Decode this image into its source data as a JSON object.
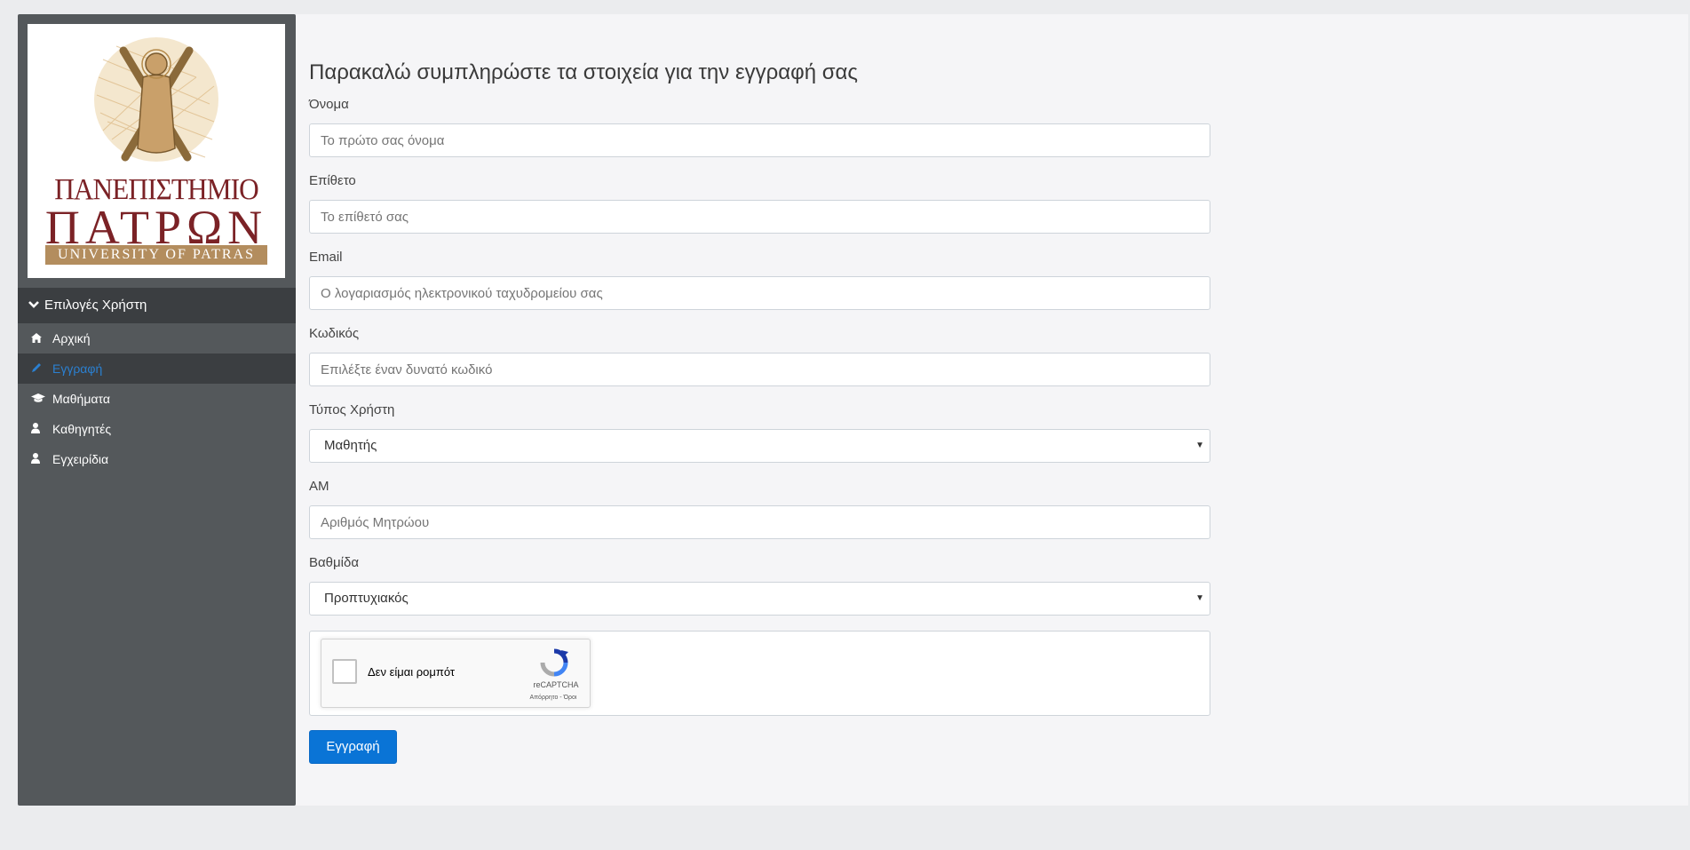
{
  "sidebar": {
    "logo": {
      "greek_line1": "ΠΑΝΕΠΙΣΤΗΜΙΟ",
      "greek_line2": "ΠΑΤΡΩΝ",
      "english": "UNIVERSITY OF PATRAS"
    },
    "menu_header": "Επιλογές Χρήστη",
    "items": [
      {
        "label": "Αρχική",
        "icon": "home-icon"
      },
      {
        "label": "Εγγραφή",
        "icon": "pencil-icon"
      },
      {
        "label": "Μαθήματα",
        "icon": "graduation-cap-icon"
      },
      {
        "label": "Καθηγητές",
        "icon": "user-icon"
      },
      {
        "label": "Εγχειρίδια",
        "icon": "user-icon"
      }
    ]
  },
  "form": {
    "title": "Παρακαλώ συμπληρώστε τα στοιχεία για την εγγραφή σας",
    "first_name": {
      "label": "Όνομα",
      "placeholder": "Το πρώτο σας όνομα"
    },
    "last_name": {
      "label": "Επίθετο",
      "placeholder": "Το επίθετό σας"
    },
    "email": {
      "label": "Email",
      "placeholder": "Ο λογαριασμός ηλεκτρονικού ταχυδρομείου σας"
    },
    "password": {
      "label": "Κωδικός",
      "placeholder": "Επιλέξτε έναν δυνατό κωδικό"
    },
    "user_type": {
      "label": "Τύπος Χρήστη",
      "value": "Μαθητής"
    },
    "am": {
      "label": "ΑΜ",
      "placeholder": "Αριθμός Μητρώου"
    },
    "level": {
      "label": "Βαθμίδα",
      "value": "Προπτυχιακός"
    },
    "captcha": {
      "label": "Δεν είμαι ρομπότ",
      "brand": "reCAPTCHA",
      "links": "Απόρρητο - Όροι"
    },
    "submit_label": "Εγγραφή"
  },
  "colors": {
    "sidebar_bg": "#54585b",
    "menu_active_bg": "#3b3e41",
    "accent": "#0a74d6",
    "active_text": "#2b80d1"
  }
}
